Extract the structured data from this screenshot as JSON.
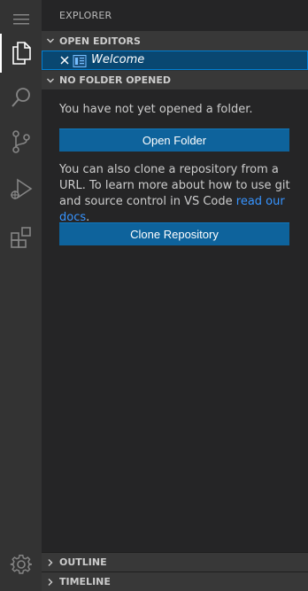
{
  "sidebar": {
    "title": "EXPLORER",
    "open_editors": {
      "header": "OPEN EDITORS",
      "items": [
        {
          "label": "Welcome",
          "icon": "welcome-file-icon"
        }
      ]
    },
    "no_folder": {
      "header": "NO FOLDER OPENED",
      "message": "You have not yet opened a folder.",
      "open_folder_label": "Open Folder",
      "clone_message": "You can also clone a repository from a URL. To learn more about how to use git and source control in VS Code ",
      "clone_link": "read our docs",
      "clone_message_end": ".",
      "clone_button_label": "Clone Repository"
    },
    "outline": {
      "header": "OUTLINE"
    },
    "timeline": {
      "header": "TIMELINE"
    }
  },
  "activity_bar": {
    "items": [
      "menu-icon",
      "explorer-icon",
      "search-icon",
      "source-control-icon",
      "run-debug-icon",
      "extensions-icon",
      "settings-gear-icon"
    ]
  },
  "colors": {
    "accent": "#0e639c",
    "selection": "#094771",
    "link": "#3794ff"
  }
}
